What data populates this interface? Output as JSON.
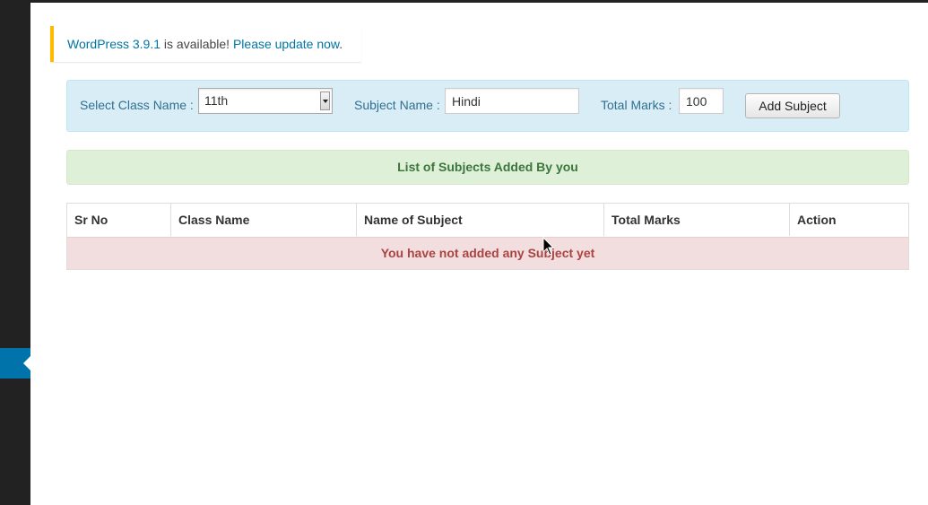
{
  "notice": {
    "link_version": "WordPress 3.9.1",
    "text_available": " is available! ",
    "link_update": "Please update now",
    "text_period": "."
  },
  "form": {
    "class_label": "Select Class Name :",
    "class_selected": "11th",
    "subject_label": "Subject Name :",
    "subject_value": "Hindi",
    "marks_label": "Total Marks :",
    "marks_value": "100",
    "add_button": "Add Subject"
  },
  "list_heading": "List of Subjects Added By you",
  "table": {
    "columns": [
      "Sr No",
      "Class Name",
      "Name of Subject",
      "Total Marks",
      "Action"
    ],
    "empty_message": "You have not added any Subject yet"
  },
  "colors": {
    "notice_border": "#ffba00",
    "link": "#0074a2",
    "info_bg": "#d9edf7",
    "success_bg": "#dff0d8",
    "danger_bg": "#f2dede",
    "admin_bar": "#222222",
    "menu_active": "#0073aa"
  }
}
